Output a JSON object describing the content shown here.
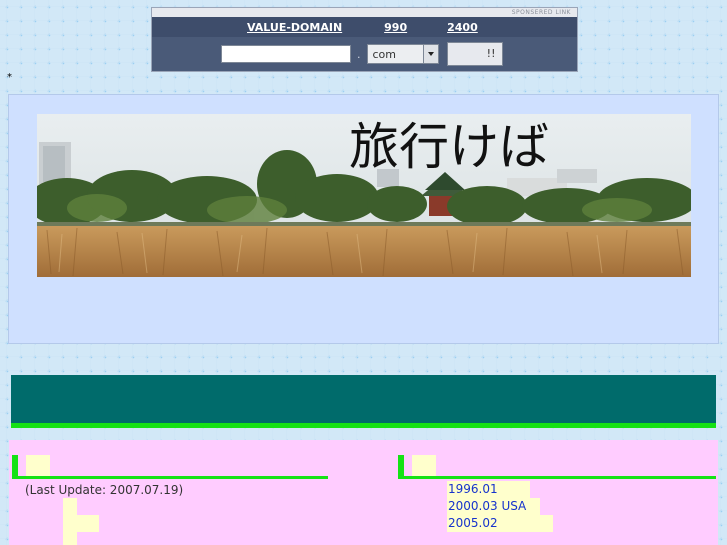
{
  "sponsor": {
    "top_label": "SPONSERED LINK",
    "promo_link": "VALUE-DOMAIN",
    "promo_price1": "990",
    "promo_price2": "2400",
    "input_value": "",
    "dot": ".",
    "tld_selected": "com",
    "submit_label": "!!"
  },
  "page": {
    "asterisk": "*",
    "banner_title": "旅行けば"
  },
  "content": {
    "last_update": "(Last Update: 2007.07.19)",
    "history": [
      "1996.01",
      "2000.03 USA",
      "2005.02"
    ]
  },
  "colors": {
    "header_bg": "#cfe0ff",
    "teal_bar": "#006b6b",
    "accent_green": "#15e215",
    "content_bg": "#ffccff",
    "highlight": "#ffffcc",
    "link_blue": "#1633cc"
  }
}
